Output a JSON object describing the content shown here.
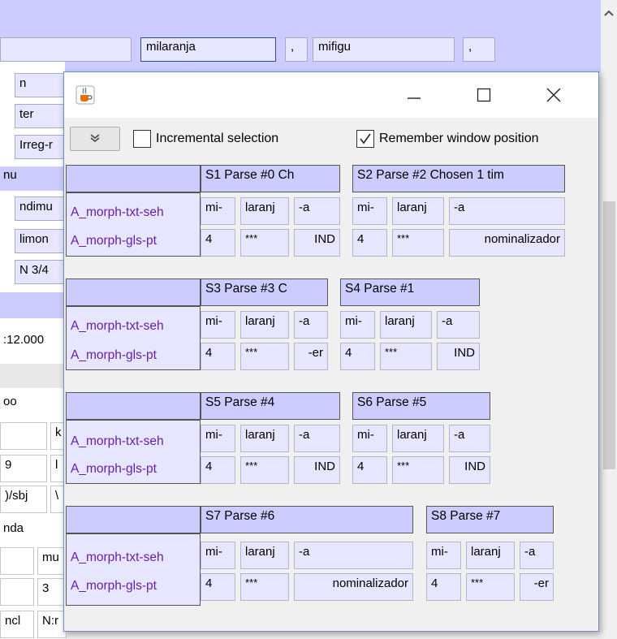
{
  "background": {
    "fields": [
      "milaranja",
      ",",
      "mifigu",
      ","
    ],
    "left_cells": [
      "n",
      "ter",
      "Irreg-r",
      "nu",
      "ndimu",
      "limon",
      "N 3/4",
      ":12.000",
      "oo",
      "k",
      "9",
      "l",
      ")/sbj",
      "\\",
      "nda",
      "mu",
      "3",
      "ncl",
      "N:r"
    ]
  },
  "dialog": {
    "toolbar": {
      "incremental_label": "Incremental selection",
      "incremental_checked": false,
      "remember_label": "Remember window position",
      "remember_checked": true
    },
    "row_labels": [
      "A_morph-txt-seh",
      "A_morph-gls-pt"
    ],
    "groups": [
      {
        "parses": [
          {
            "header": "S1 Parse #0 Ch",
            "txt": [
              "mi-",
              "laranj",
              "-a"
            ],
            "gls": [
              "4",
              "***",
              "IND"
            ]
          },
          {
            "header": "S2 Parse #2 Chosen 1 tim",
            "txt": [
              "mi-",
              "laranj",
              "-a"
            ],
            "gls": [
              "4",
              "***",
              "nominalizador"
            ]
          }
        ]
      },
      {
        "parses": [
          {
            "header": "S3 Parse #3 C",
            "txt": [
              "mi-",
              "laranj",
              "-a"
            ],
            "gls": [
              "4",
              "***",
              "-er"
            ]
          },
          {
            "header": "S4 Parse #1",
            "txt": [
              "mi-",
              "laranj",
              "-a"
            ],
            "gls": [
              "4",
              "***",
              "IND"
            ]
          }
        ]
      },
      {
        "parses": [
          {
            "header": "S5 Parse #4",
            "txt": [
              "mi-",
              "laranj",
              "-a"
            ],
            "gls": [
              "4",
              "***",
              "IND"
            ]
          },
          {
            "header": "S6 Parse #5",
            "txt": [
              "mi-",
              "laranj",
              "-a"
            ],
            "gls": [
              "4",
              "***",
              "IND"
            ]
          }
        ]
      },
      {
        "parses": [
          {
            "header": "S7 Parse #6",
            "txt": [
              "mi-",
              "laranj",
              "-a"
            ],
            "gls": [
              "4",
              "***",
              "nominalizador"
            ]
          },
          {
            "header": "S8 Parse #7",
            "txt": [
              "mi-",
              "laranj",
              "-a"
            ],
            "gls": [
              "4",
              "***",
              "-er"
            ]
          }
        ]
      }
    ],
    "icons": {
      "app": "java-coffee-cup-icon",
      "minimize": "minimize-icon",
      "maximize": "maximize-icon",
      "close": "close-icon",
      "dropdown": "chevron-down-icon",
      "scroll_up": "scroll-up-arrow-icon"
    }
  }
}
